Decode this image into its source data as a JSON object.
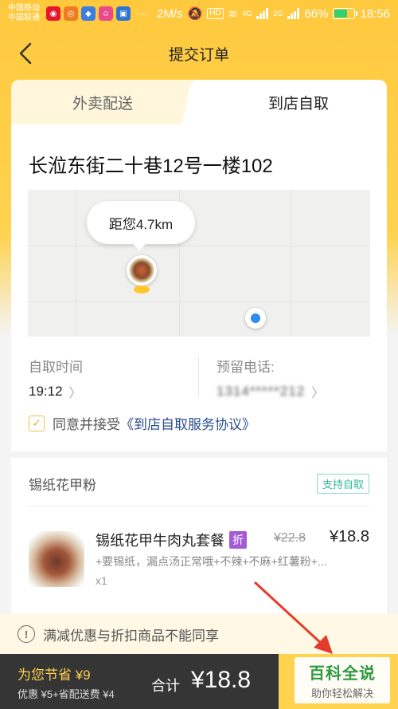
{
  "status_bar": {
    "carrier_1": "中国移动",
    "carrier_2": "中国联通",
    "speed": "2M/s",
    "hd_label": "HD",
    "network_4g": "4G",
    "network_2g": "2G",
    "battery": "66%",
    "battery_level": 0.66,
    "time": "18:56",
    "app_icons": [
      "weibo-icon",
      "weibo-icon",
      "app-icon",
      "app-icon",
      "app-icon"
    ]
  },
  "header": {
    "title": "提交订单"
  },
  "tabs": {
    "delivery": "外卖配送",
    "pickup": "到店自取",
    "active": "pickup"
  },
  "pickup": {
    "address": "长涖东街二十巷12号一楼102",
    "distance": "距您4.7km",
    "time_label": "自取时间",
    "time_value": "19:12",
    "phone_label": "预留电话:",
    "phone_value": "1314*****212",
    "agree_text": "同意并接受",
    "agree_link": "《到店自取服务协议》",
    "agreed": true
  },
  "order": {
    "shop_name": "锡纸花甲粉",
    "badge": "支持自取",
    "items": [
      {
        "name": "锡纸花甲牛肉丸套餐",
        "tag": "折",
        "original_price": "¥22.8",
        "price": "¥18.8",
        "desc": "+要锡纸，漏点汤正常哦+不辣+不麻+红薯粉+...",
        "qty": "x1"
      }
    ]
  },
  "notice": {
    "text": "满减优惠与折扣商品不能同享"
  },
  "bottom_bar": {
    "save_title": "为您节省 ¥9",
    "save_detail": "优惠 ¥5+省配送费 ¥4",
    "total_label": "合计",
    "total_value": "¥18.8"
  },
  "watermark": {
    "main": "百科全说",
    "sub": "助你轻松解决"
  },
  "colors": {
    "brand_yellow": "#ffd24f",
    "link_blue": "#2a4e8c",
    "badge_green": "#35b79d",
    "tag_purple": "#a55ad6",
    "arrow_red": "#e53b2c"
  }
}
